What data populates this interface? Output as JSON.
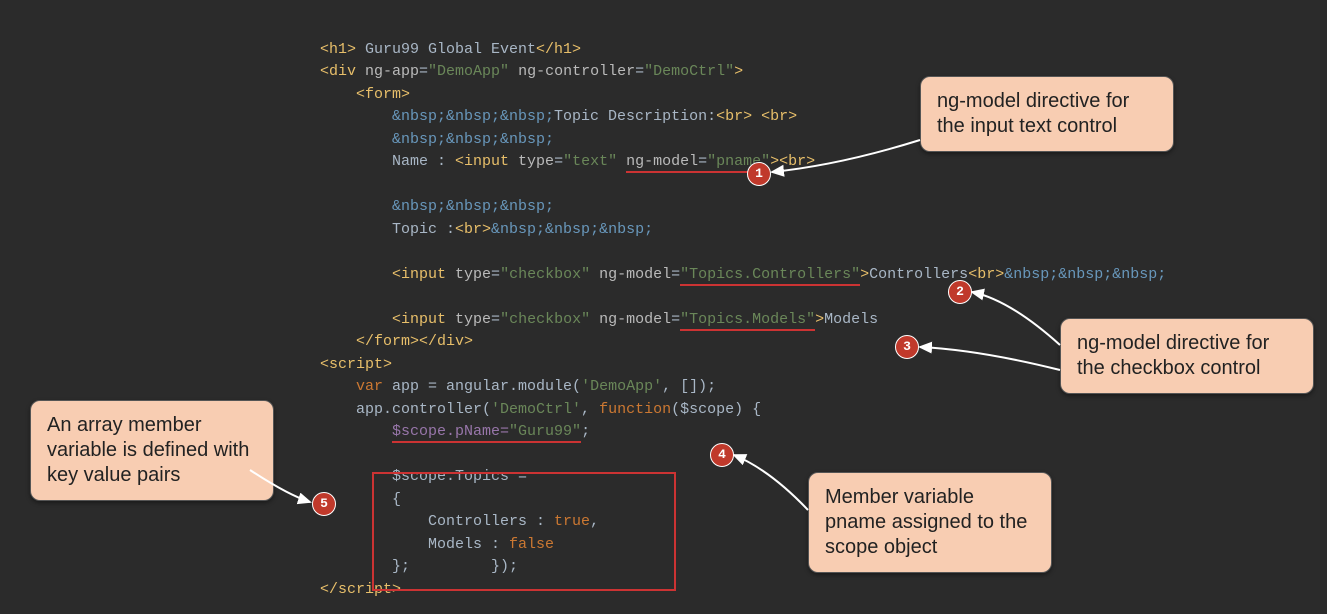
{
  "code": {
    "l1a": "<h1>",
    "l1b": " Guru99 Global Event",
    "l1c": "</h1>",
    "l2a": "<div ",
    "l2b": "ng-app",
    "l2c": "=",
    "l2d": "\"DemoApp\"",
    "l2e": " ng-controller",
    "l2f": "=",
    "l2g": "\"DemoCtrl\"",
    "l2h": ">",
    "l3a": "    ",
    "l3b": "<form>",
    "l4a": "        ",
    "l4b": "&nbsp;&nbsp;&nbsp;",
    "l4c": "Topic Description:",
    "l4d": "<br>",
    "l4e": " ",
    "l4f": "<br>",
    "l5a": "        ",
    "l5b": "&nbsp;&nbsp;&nbsp;",
    "l6a": "        Name : ",
    "l6b": "<input ",
    "l6c": "type",
    "l6d": "=",
    "l6e": "\"text\"",
    "l6f": " ",
    "l6g": "ng-model",
    "l6h": "=",
    "l6i": "\"pname\"",
    "l6j": ">",
    "l6k": "<br>",
    "l7": "",
    "l8a": "        ",
    "l8b": "&nbsp;&nbsp;&nbsp;",
    "l9a": "        Topic :",
    "l9b": "<br>",
    "l9c": "&nbsp;&nbsp;&nbsp;",
    "l10": "",
    "l11a": "        ",
    "l11b": "<input ",
    "l11c": "type",
    "l11d": "=",
    "l11e": "\"checkbox\"",
    "l11f": " ",
    "l11g": "ng-model",
    "l11h": "=",
    "l11i": "\"Topics.Controllers\"",
    "l11j": ">",
    "l11k": "Controllers",
    "l11l": "<br>",
    "l11m": "&nbsp;&nbsp;&nbsp;",
    "l12": "",
    "l13a": "        ",
    "l13b": "<input ",
    "l13c": "type",
    "l13d": "=",
    "l13e": "\"checkbox\"",
    "l13f": " ",
    "l13g": "ng-model",
    "l13h": "=",
    "l13i": "\"Topics.Models\"",
    "l13j": ">",
    "l13k": "Models",
    "l14a": "    ",
    "l14b": "</form>",
    "l14c": "</div>",
    "l15": "<script>",
    "l16a": "    ",
    "l16b": "var",
    "l16c": " app = angular.module(",
    "l16d": "'DemoApp'",
    "l16e": ", []);",
    "l17a": "    app.controller(",
    "l17b": "'DemoCtrl'",
    "l17c": ", ",
    "l17d": "function",
    "l17e": "($scope) {",
    "l18a": "        ",
    "l18b": "$scope.pName=",
    "l18c": "\"Guru99\"",
    "l18d": ";",
    "l19": "",
    "l20a": "        $scope.Topics =",
    "l21a": "        {",
    "l22a": "            Controllers : ",
    "l22b": "true",
    "l22c": ",",
    "l23a": "            Models : ",
    "l23b": "false",
    "l24a": "        };         });",
    "l25": "</script>"
  },
  "callouts": {
    "c1": "ng-model directive for the input text control",
    "c2": "ng-model directive for the checkbox control",
    "c3": "Member variable pname assigned to the scope object",
    "c4": "An array member variable is defined with key value pairs"
  },
  "badges": {
    "b1": "1",
    "b2": "2",
    "b3": "3",
    "b4": "4",
    "b5": "5"
  }
}
